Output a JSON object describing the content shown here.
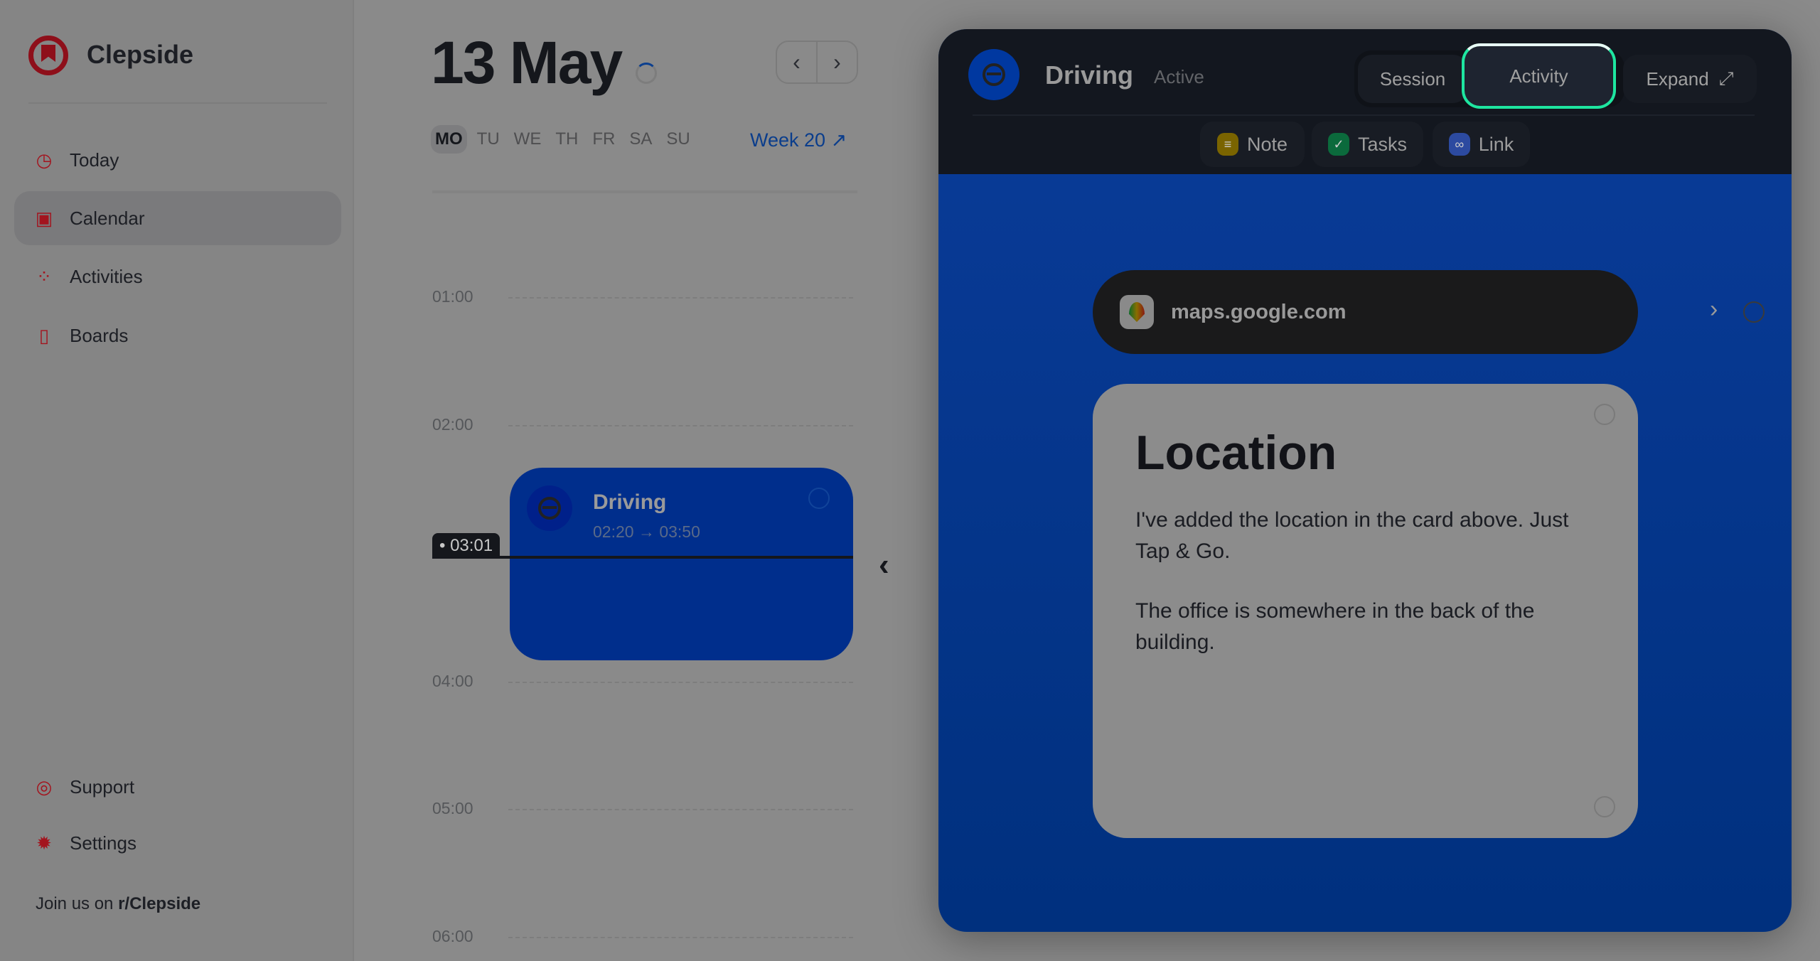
{
  "sidebar": {
    "brand": "Clepside",
    "items": [
      {
        "label": "Today",
        "icon": "clock-icon"
      },
      {
        "label": "Calendar",
        "icon": "calendar-icon",
        "active": true
      },
      {
        "label": "Activities",
        "icon": "activities-icon"
      },
      {
        "label": "Boards",
        "icon": "boards-icon"
      }
    ],
    "bottom": [
      {
        "label": "Support",
        "icon": "lifebuoy-icon"
      },
      {
        "label": "Settings",
        "icon": "gear-icon"
      }
    ],
    "join_prefix": "Join us on ",
    "join_link": "r/Clepside"
  },
  "calendar": {
    "title": "13 May",
    "days": [
      "MO",
      "TU",
      "WE",
      "TH",
      "FR",
      "SA",
      "SU"
    ],
    "selected_day": "MO",
    "week": "Week 20 ↗",
    "hours": [
      "01:00",
      "02:00",
      "04:00",
      "05:00",
      "06:00"
    ],
    "now": "03:01",
    "event": {
      "title": "Driving",
      "time": "02:20 → 03:50",
      "color": "#002e8c"
    }
  },
  "panel": {
    "title": "Driving",
    "status": "Active",
    "tabs": {
      "session": "Session",
      "activity": "Activity",
      "expand": "Expand"
    },
    "active_tab": "Activity",
    "accent": "#1ee6a0",
    "tools": [
      {
        "label": "Note",
        "color": "#7a6400"
      },
      {
        "label": "Tasks",
        "color": "#0b6a3c"
      },
      {
        "label": "Link",
        "color": "#2c4aa0"
      }
    ],
    "link": {
      "url": "maps.google.com"
    },
    "note": {
      "title": "Location",
      "paragraphs": [
        "I've added the location in the card above. Just Tap & Go.",
        "The office is somewhere in the back of the building."
      ]
    }
  }
}
